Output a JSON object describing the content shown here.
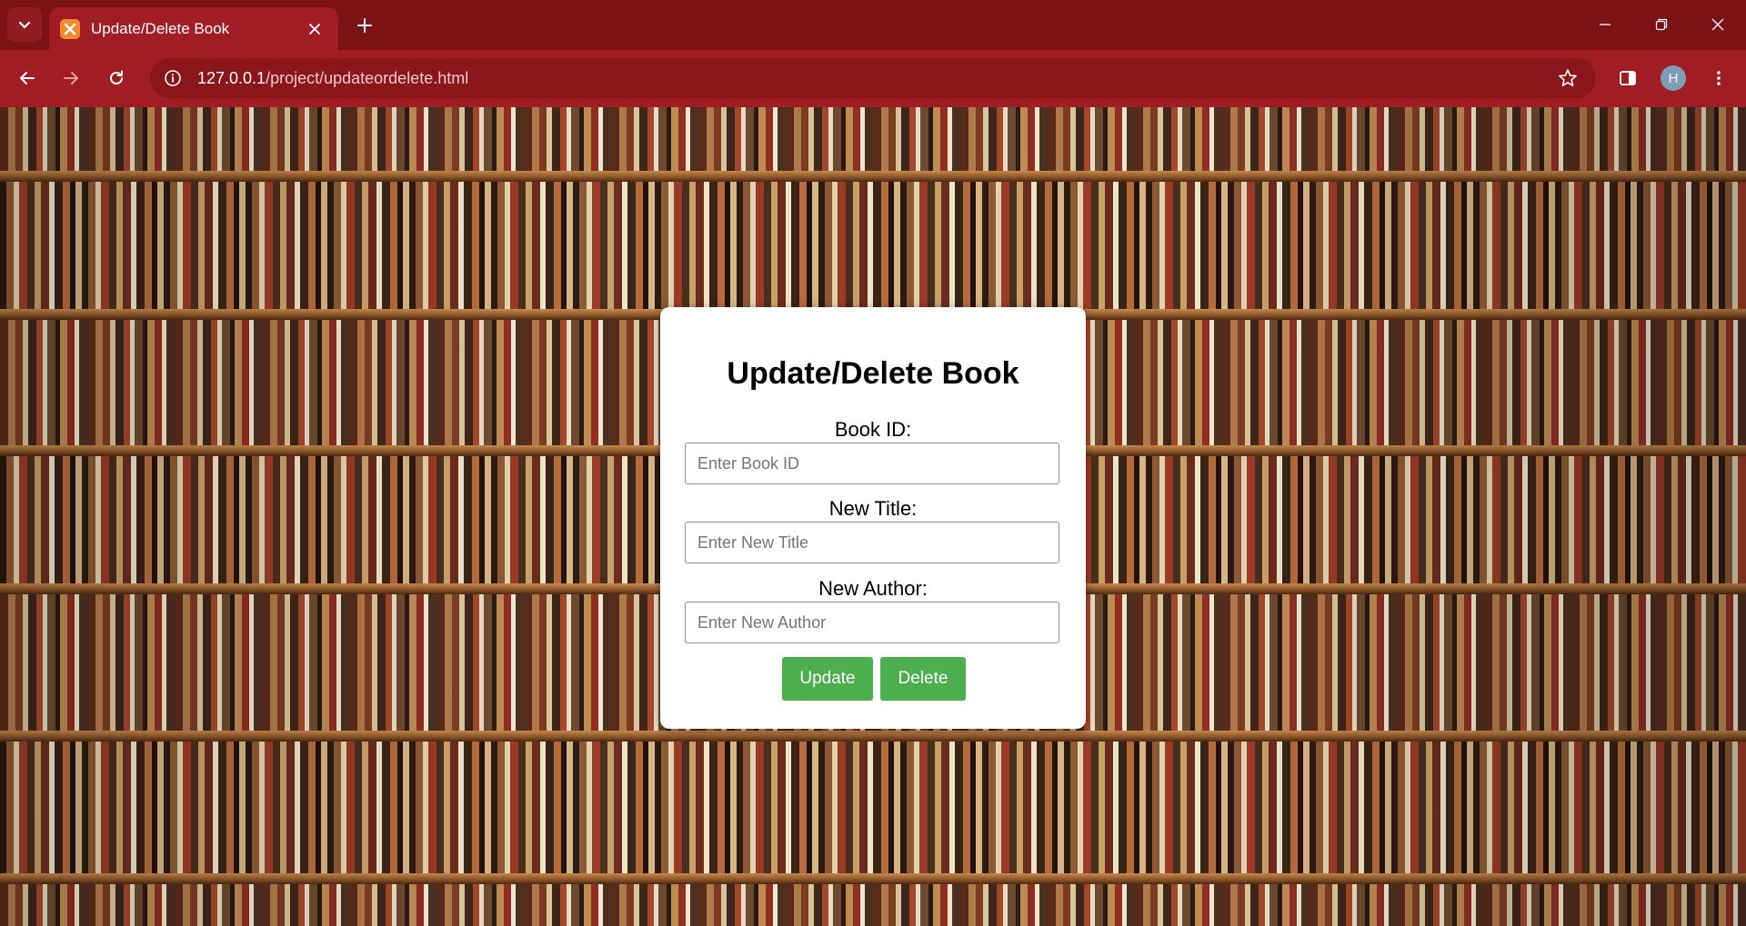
{
  "browser": {
    "tab_title": "Update/Delete Book",
    "url_host": "127.0.0.1",
    "url_path": "/project/updateordelete.html",
    "profile_initial": "H",
    "theme_color": "#a11d24"
  },
  "form": {
    "title": "Update/Delete Book",
    "book_id": {
      "label": "Book ID:",
      "placeholder": "Enter Book ID",
      "value": ""
    },
    "new_title": {
      "label": "New Title:",
      "placeholder": "Enter New Title",
      "value": ""
    },
    "new_author": {
      "label": "New Author:",
      "placeholder": "Enter New Author",
      "value": ""
    },
    "update_label": "Update",
    "delete_label": "Delete",
    "button_color": "#4cae4f"
  },
  "icons": {
    "tab_search": "chevron-down-icon",
    "close": "close-icon",
    "new_tab": "plus-icon",
    "back": "back-arrow-icon",
    "forward": "forward-arrow-icon",
    "reload": "reload-icon",
    "site_info": "info-icon",
    "bookmark": "star-icon",
    "side_panel": "side-panel-icon",
    "menu": "kebab-menu-icon"
  }
}
